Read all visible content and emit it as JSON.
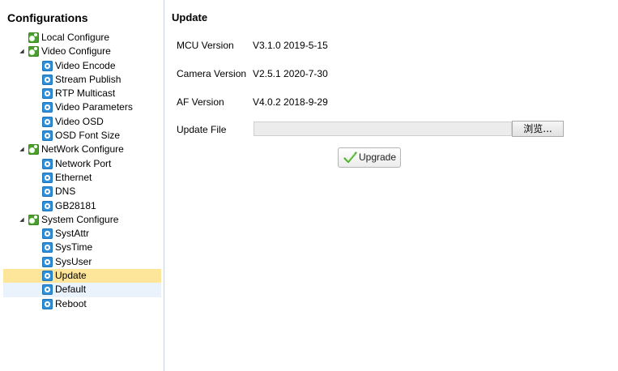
{
  "sidebar": {
    "title": "Configurations",
    "items": [
      {
        "label": "Local Configure",
        "level": 1,
        "icon": "group-gear-icon"
      },
      {
        "label": "Video Configure",
        "level": 1,
        "icon": "group-gear-icon",
        "expanded": true
      },
      {
        "label": "Video Encode",
        "level": 2,
        "icon": "gear-icon"
      },
      {
        "label": "Stream Publish",
        "level": 2,
        "icon": "gear-icon"
      },
      {
        "label": "RTP Multicast",
        "level": 2,
        "icon": "gear-icon"
      },
      {
        "label": "Video Parameters",
        "level": 2,
        "icon": "gear-icon"
      },
      {
        "label": "Video OSD",
        "level": 2,
        "icon": "gear-icon"
      },
      {
        "label": "OSD Font Size",
        "level": 2,
        "icon": "gear-icon"
      },
      {
        "label": "NetWork Configure",
        "level": 1,
        "icon": "group-gear-icon",
        "expanded": true
      },
      {
        "label": "Network Port",
        "level": 2,
        "icon": "gear-icon"
      },
      {
        "label": "Ethernet",
        "level": 2,
        "icon": "gear-icon"
      },
      {
        "label": "DNS",
        "level": 2,
        "icon": "gear-icon"
      },
      {
        "label": "GB28181",
        "level": 2,
        "icon": "gear-icon"
      },
      {
        "label": "System Configure",
        "level": 1,
        "icon": "group-gear-icon",
        "expanded": true
      },
      {
        "label": "SystAttr",
        "level": 2,
        "icon": "gear-icon"
      },
      {
        "label": "SysTime",
        "level": 2,
        "icon": "gear-icon"
      },
      {
        "label": "SysUser",
        "level": 2,
        "icon": "gear-icon"
      },
      {
        "label": "Update",
        "level": 2,
        "icon": "gear-icon",
        "selected": true
      },
      {
        "label": "Default",
        "level": 2,
        "icon": "gear-icon",
        "hover": true
      },
      {
        "label": "Reboot",
        "level": 2,
        "icon": "gear-icon"
      }
    ]
  },
  "main": {
    "title": "Update",
    "mcu_label": "MCU Version",
    "mcu_value": "V3.1.0 2019-5-15",
    "camera_label": "Camera Version",
    "camera_value": "V2.5.1 2020-7-30",
    "af_label": "AF Version",
    "af_value": "V4.0.2 2018-9-29",
    "file_label": "Update File",
    "file_value": "",
    "browse_label": "浏览...",
    "upgrade_label": "Upgrade"
  },
  "colors": {
    "selected_bg": "#fde59a",
    "hover_bg": "#eaf2fb",
    "group_icon": "#4aa02c",
    "leaf_icon": "#2f8fd9",
    "check_icon": "#4caf2a"
  }
}
